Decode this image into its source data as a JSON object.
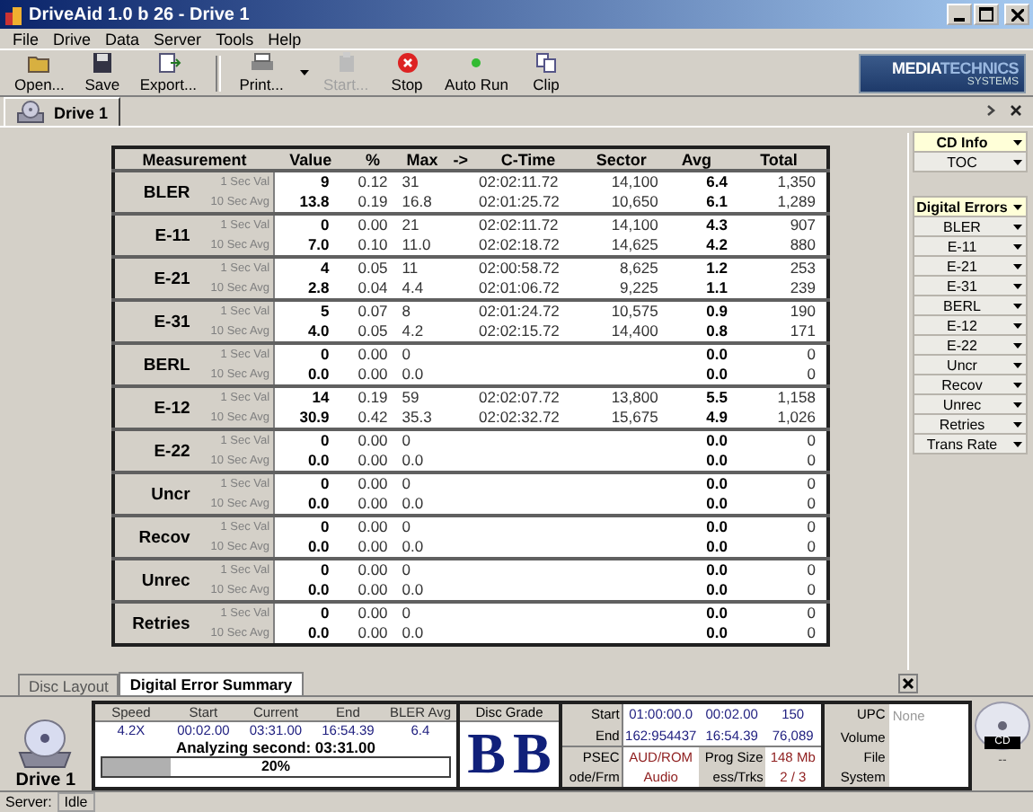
{
  "window": {
    "title": "DriveAid 1.0 b 26 - Drive 1"
  },
  "menu": [
    "File",
    "Drive",
    "Data",
    "Server",
    "Tools",
    "Help"
  ],
  "toolbar_groups": [
    [
      {
        "kind": "open",
        "label": "Open...",
        "disabled": false
      },
      {
        "kind": "save",
        "label": "Save",
        "disabled": false
      },
      {
        "kind": "export",
        "label": "Export...",
        "disabled": false
      }
    ],
    [
      {
        "kind": "print",
        "label": "Print...",
        "disabled": false,
        "dropdown": true
      },
      {
        "kind": "start",
        "label": "Start...",
        "disabled": true
      },
      {
        "kind": "stop",
        "label": "Stop",
        "disabled": false
      },
      {
        "kind": "autorun",
        "label": "Auto Run",
        "disabled": false
      },
      {
        "kind": "clip",
        "label": "Clip",
        "disabled": false
      }
    ]
  ],
  "logo": {
    "line1a": "MEDIA",
    "line1b": "TECHNICS",
    "line2": "SYSTEMS"
  },
  "document_tab": {
    "label": "Drive 1"
  },
  "table": {
    "columns": [
      "Measurement",
      "Value",
      "%",
      "Max",
      "->",
      "C-Time",
      "Sector",
      "Avg",
      "Total"
    ],
    "groups": [
      {
        "name": "BLER",
        "rows": [
          {
            "label": "1 Sec Val",
            "value": "9",
            "pct": "0.12",
            "max": "31",
            "ctime": "02:02:11.72",
            "sector": "14,100",
            "avg": "6.4",
            "total": "1,350"
          },
          {
            "label": "10 Sec Avg",
            "value": "13.8",
            "pct": "0.19",
            "max": "16.8",
            "ctime": "02:01:25.72",
            "sector": "10,650",
            "avg": "6.1",
            "total": "1,289"
          }
        ]
      },
      {
        "name": "E-11",
        "rows": [
          {
            "label": "1 Sec Val",
            "value": "0",
            "pct": "0.00",
            "max": "21",
            "ctime": "02:02:11.72",
            "sector": "14,100",
            "avg": "4.3",
            "total": "907"
          },
          {
            "label": "10 Sec Avg",
            "value": "7.0",
            "pct": "0.10",
            "max": "11.0",
            "ctime": "02:02:18.72",
            "sector": "14,625",
            "avg": "4.2",
            "total": "880"
          }
        ]
      },
      {
        "name": "E-21",
        "rows": [
          {
            "label": "1 Sec Val",
            "value": "4",
            "pct": "0.05",
            "max": "11",
            "ctime": "02:00:58.72",
            "sector": "8,625",
            "avg": "1.2",
            "total": "253"
          },
          {
            "label": "10 Sec Avg",
            "value": "2.8",
            "pct": "0.04",
            "max": "4.4",
            "ctime": "02:01:06.72",
            "sector": "9,225",
            "avg": "1.1",
            "total": "239"
          }
        ]
      },
      {
        "name": "E-31",
        "rows": [
          {
            "label": "1 Sec Val",
            "value": "5",
            "pct": "0.07",
            "max": "8",
            "ctime": "02:01:24.72",
            "sector": "10,575",
            "avg": "0.9",
            "total": "190"
          },
          {
            "label": "10 Sec Avg",
            "value": "4.0",
            "pct": "0.05",
            "max": "4.2",
            "ctime": "02:02:15.72",
            "sector": "14,400",
            "avg": "0.8",
            "total": "171"
          }
        ]
      },
      {
        "name": "BERL",
        "rows": [
          {
            "label": "1 Sec Val",
            "value": "0",
            "pct": "0.00",
            "max": "0",
            "avg": "0.0",
            "total": "0"
          },
          {
            "label": "10 Sec Avg",
            "value": "0.0",
            "pct": "0.00",
            "max": "0.0",
            "avg": "0.0",
            "total": "0"
          }
        ]
      },
      {
        "name": "E-12",
        "rows": [
          {
            "label": "1 Sec Val",
            "value": "14",
            "pct": "0.19",
            "max": "59",
            "ctime": "02:02:07.72",
            "sector": "13,800",
            "avg": "5.5",
            "total": "1,158"
          },
          {
            "label": "10 Sec Avg",
            "value": "30.9",
            "pct": "0.42",
            "max": "35.3",
            "ctime": "02:02:32.72",
            "sector": "15,675",
            "avg": "4.9",
            "total": "1,026"
          }
        ]
      },
      {
        "name": "E-22",
        "rows": [
          {
            "label": "1 Sec Val",
            "value": "0",
            "pct": "0.00",
            "max": "0",
            "avg": "0.0",
            "total": "0"
          },
          {
            "label": "10 Sec Avg",
            "value": "0.0",
            "pct": "0.00",
            "max": "0.0",
            "avg": "0.0",
            "total": "0"
          }
        ]
      },
      {
        "name": "Uncr",
        "rows": [
          {
            "label": "1 Sec Val",
            "value": "0",
            "pct": "0.00",
            "max": "0",
            "avg": "0.0",
            "total": "0"
          },
          {
            "label": "10 Sec Avg",
            "value": "0.0",
            "pct": "0.00",
            "max": "0.0",
            "avg": "0.0",
            "total": "0"
          }
        ]
      },
      {
        "name": "Recov",
        "rows": [
          {
            "label": "1 Sec Val",
            "value": "0",
            "pct": "0.00",
            "max": "0",
            "avg": "0.0",
            "total": "0"
          },
          {
            "label": "10 Sec Avg",
            "value": "0.0",
            "pct": "0.00",
            "max": "0.0",
            "avg": "0.0",
            "total": "0"
          }
        ]
      },
      {
        "name": "Unrec",
        "rows": [
          {
            "label": "1 Sec Val",
            "value": "0",
            "pct": "0.00",
            "max": "0",
            "avg": "0.0",
            "total": "0"
          },
          {
            "label": "10 Sec Avg",
            "value": "0.0",
            "pct": "0.00",
            "max": "0.0",
            "avg": "0.0",
            "total": "0"
          }
        ]
      },
      {
        "name": "Retries",
        "rows": [
          {
            "label": "1 Sec Val",
            "value": "0",
            "pct": "0.00",
            "max": "0",
            "avg": "0.0",
            "total": "0"
          },
          {
            "label": "10 Sec Avg",
            "value": "0.0",
            "pct": "0.00",
            "max": "0.0",
            "avg": "0.0",
            "total": "0"
          }
        ]
      }
    ]
  },
  "side_panel": [
    {
      "header": "CD Info",
      "items": [
        "TOC"
      ]
    },
    {
      "header": "Digital Errors",
      "items": [
        "BLER",
        "E-11",
        "E-21",
        "E-31",
        "BERL",
        "E-12",
        "E-22",
        "Uncr",
        "Recov",
        "Unrec",
        "Retries",
        "Trans Rate"
      ]
    }
  ],
  "bottom_tabs": [
    {
      "label": "Disc Layout",
      "selected": false
    },
    {
      "label": "Digital Error Summary",
      "selected": true
    }
  ],
  "summary": {
    "drive_label": "Drive 1",
    "columns": [
      "Speed",
      "Start",
      "Current",
      "End",
      "BLER Avg"
    ],
    "values": [
      "4.2X",
      "00:02.00",
      "03:31.00",
      "16:54.39",
      "6.4"
    ],
    "status": "Analyzing second: 03:31.00",
    "progress": {
      "level": 0.2,
      "text": "20%"
    },
    "grade_label": "Disc Grade",
    "grades": [
      "B",
      "B"
    ],
    "info_rows": [
      [
        {
          "kind": "label",
          "text": "Start"
        },
        {
          "kind": "value",
          "text": "01:00:00.0"
        },
        {
          "kind": "value",
          "text": "00:02.00"
        },
        {
          "kind": "value",
          "text": "150"
        }
      ],
      [
        {
          "kind": "label",
          "text": "End"
        },
        {
          "kind": "value",
          "text": "162:954437"
        },
        {
          "kind": "value",
          "text": "16:54.39"
        },
        {
          "kind": "value",
          "text": "76,089"
        }
      ],
      [
        {
          "kind": "label",
          "text": "PSEC"
        },
        {
          "kind": "alert",
          "text": "AUD/ROM"
        },
        {
          "kind": "label",
          "text": "Prog Size"
        },
        {
          "kind": "alert",
          "text": "148 Mb"
        }
      ],
      [
        {
          "kind": "label",
          "text": "ode/Frm"
        },
        {
          "kind": "alert",
          "text": "Audio"
        },
        {
          "kind": "label",
          "text": "ess/Trks"
        },
        {
          "kind": "alert",
          "text": "2 / 3"
        }
      ]
    ],
    "disc_fields": [
      {
        "label": "UPC",
        "value": "None"
      },
      {
        "label": "Volume"
      },
      {
        "label": "File System"
      }
    ],
    "disc_icon_label": "CD",
    "disc_status": "--"
  },
  "status_bar": {
    "label": "Server:",
    "value": "Idle"
  }
}
